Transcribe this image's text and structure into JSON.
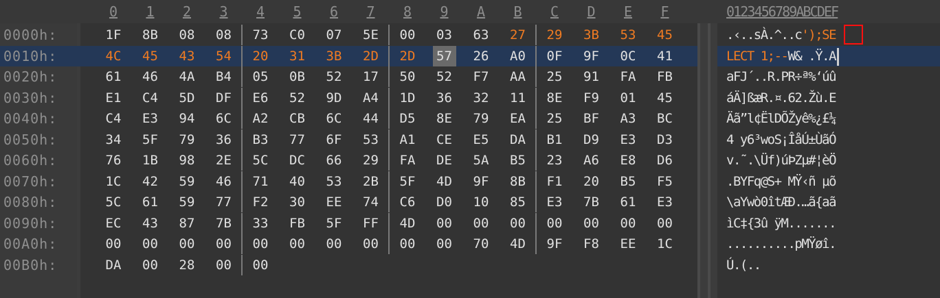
{
  "header": {
    "columns": [
      "0",
      "1",
      "2",
      "3",
      "4",
      "5",
      "6",
      "7",
      "8",
      "9",
      "A",
      "B",
      "C",
      "D",
      "E",
      "F"
    ],
    "ascii": "0123456789ABCDEF"
  },
  "rows": [
    {
      "offset": "0000h:",
      "bytes": [
        "1F",
        "8B",
        "08",
        "08",
        "73",
        "C0",
        "07",
        "5E",
        "00",
        "03",
        "63",
        "27",
        "29",
        "3B",
        "53",
        "45"
      ],
      "ascii": ".‹..sÀ.^..c');SE"
    },
    {
      "offset": "0010h:",
      "bytes": [
        "4C",
        "45",
        "43",
        "54",
        "20",
        "31",
        "3B",
        "2D",
        "2D",
        "57",
        "26",
        "A0",
        "0F",
        "9F",
        "0C",
        "41"
      ],
      "ascii": "LECT 1;--W& .Ÿ.A"
    },
    {
      "offset": "0020h:",
      "bytes": [
        "61",
        "46",
        "4A",
        "B4",
        "05",
        "0B",
        "52",
        "17",
        "50",
        "52",
        "F7",
        "AA",
        "25",
        "91",
        "FA",
        "FB"
      ],
      "ascii": "aFJ´..R.PR÷ª%‘úû"
    },
    {
      "offset": "0030h:",
      "bytes": [
        "E1",
        "C4",
        "5D",
        "DF",
        "E6",
        "52",
        "9D",
        "A4",
        "1D",
        "36",
        "32",
        "11",
        "8E",
        "F9",
        "01",
        "45"
      ],
      "ascii": "áÄ]ßæR.¤.62.Žù.E"
    },
    {
      "offset": "0040h:",
      "bytes": [
        "C4",
        "E3",
        "94",
        "6C",
        "A2",
        "CB",
        "6C",
        "44",
        "D5",
        "8E",
        "79",
        "EA",
        "25",
        "BF",
        "A3",
        "BC"
      ],
      "ascii": "Äã”l¢ËlDÕŽyê%¿£¼"
    },
    {
      "offset": "0050h:",
      "bytes": [
        "34",
        "5F",
        "79",
        "36",
        "B3",
        "77",
        "6F",
        "53",
        "A1",
        "CE",
        "E5",
        "DA",
        "B1",
        "D9",
        "E3",
        "D3"
      ],
      "ascii": "4 y6³woS¡ÎåÚ±ÙãÓ"
    },
    {
      "offset": "0060h:",
      "bytes": [
        "76",
        "1B",
        "98",
        "2E",
        "5C",
        "DC",
        "66",
        "29",
        "FA",
        "DE",
        "5A",
        "B5",
        "23",
        "A6",
        "E8",
        "D6"
      ],
      "ascii": "v.˜.\\Üf)úÞZµ#¦èÖ"
    },
    {
      "offset": "0070h:",
      "bytes": [
        "1C",
        "42",
        "59",
        "46",
        "71",
        "40",
        "53",
        "2B",
        "5F",
        "4D",
        "9F",
        "8B",
        "F1",
        "20",
        "B5",
        "F5"
      ],
      "ascii": ".BYFq@S+ MŸ‹ñ µõ"
    },
    {
      "offset": "0080h:",
      "bytes": [
        "5C",
        "61",
        "59",
        "77",
        "F2",
        "30",
        "EE",
        "74",
        "C6",
        "D0",
        "10",
        "85",
        "E3",
        "7B",
        "61",
        "E3"
      ],
      "ascii": "\\aYwò0îtÆÐ.…ã{aã"
    },
    {
      "offset": "0090h:",
      "bytes": [
        "EC",
        "43",
        "87",
        "7B",
        "33",
        "FB",
        "5F",
        "FF",
        "4D",
        "00",
        "00",
        "00",
        "00",
        "00",
        "00",
        "00"
      ],
      "ascii": "ìC‡{3û ÿM......."
    },
    {
      "offset": "00A0h:",
      "bytes": [
        "00",
        "00",
        "00",
        "00",
        "00",
        "00",
        "00",
        "00",
        "00",
        "00",
        "70",
        "4D",
        "9F",
        "F8",
        "EE",
        "1C"
      ],
      "ascii": "..........pMŸøî."
    },
    {
      "offset": "00B0h:",
      "bytes": [
        "DA",
        "00",
        "28",
        "00",
        "00"
      ],
      "ascii": "Ú.(.."
    }
  ],
  "highlight": {
    "color": "#f07b22",
    "selection_bg": "#243857"
  }
}
